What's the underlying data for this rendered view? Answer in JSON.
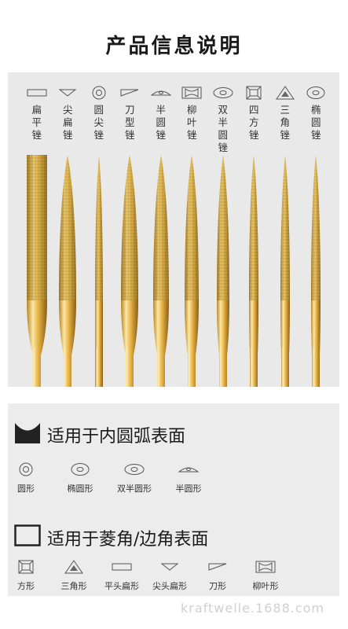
{
  "title": "产品信息说明",
  "files": [
    {
      "name": "扁平锉",
      "icon": "flat-shape-icon"
    },
    {
      "name": "尖扁锉",
      "icon": "pointed-flat-shape-icon"
    },
    {
      "name": "圆尖锉",
      "icon": "round-shape-icon"
    },
    {
      "name": "刀型锉",
      "icon": "knife-shape-icon"
    },
    {
      "name": "半圆锉",
      "icon": "half-round-shape-icon"
    },
    {
      "name": "柳叶锉",
      "icon": "willow-leaf-shape-icon"
    },
    {
      "name": "双半圆锉",
      "icon": "double-half-round-shape-icon"
    },
    {
      "name": "四方锉",
      "icon": "square-shape-icon"
    },
    {
      "name": "三角锉",
      "icon": "triangle-shape-icon"
    },
    {
      "name": "椭圆锉",
      "icon": "oval-shape-icon"
    }
  ],
  "section1": {
    "title": "适用于内圆弧表面",
    "items": [
      {
        "label": "圆形",
        "icon": "round-shape-icon"
      },
      {
        "label": "椭圆形",
        "icon": "oval-shape-icon"
      },
      {
        "label": "双半圆形",
        "icon": "double-half-round-shape-icon"
      },
      {
        "label": "半圆形",
        "icon": "half-round-shape-icon"
      }
    ]
  },
  "section2": {
    "title": "适用于菱角/边角表面",
    "items": [
      {
        "label": "方形",
        "icon": "square-shape-icon"
      },
      {
        "label": "三角形",
        "icon": "triangle-shape-icon"
      },
      {
        "label": "平头扁形",
        "icon": "flat-shape-icon"
      },
      {
        "label": "尖头扁形",
        "icon": "pointed-flat-shape-icon"
      },
      {
        "label": "刀形",
        "icon": "knife-shape-icon"
      },
      {
        "label": "柳叶形",
        "icon": "willow-leaf-shape-icon"
      }
    ]
  },
  "watermark": "kraftwelle.1688.com",
  "colors": {
    "gold": "#d4a93c",
    "gold_dark": "#a97c1f",
    "panel": "#e9e9e9"
  }
}
